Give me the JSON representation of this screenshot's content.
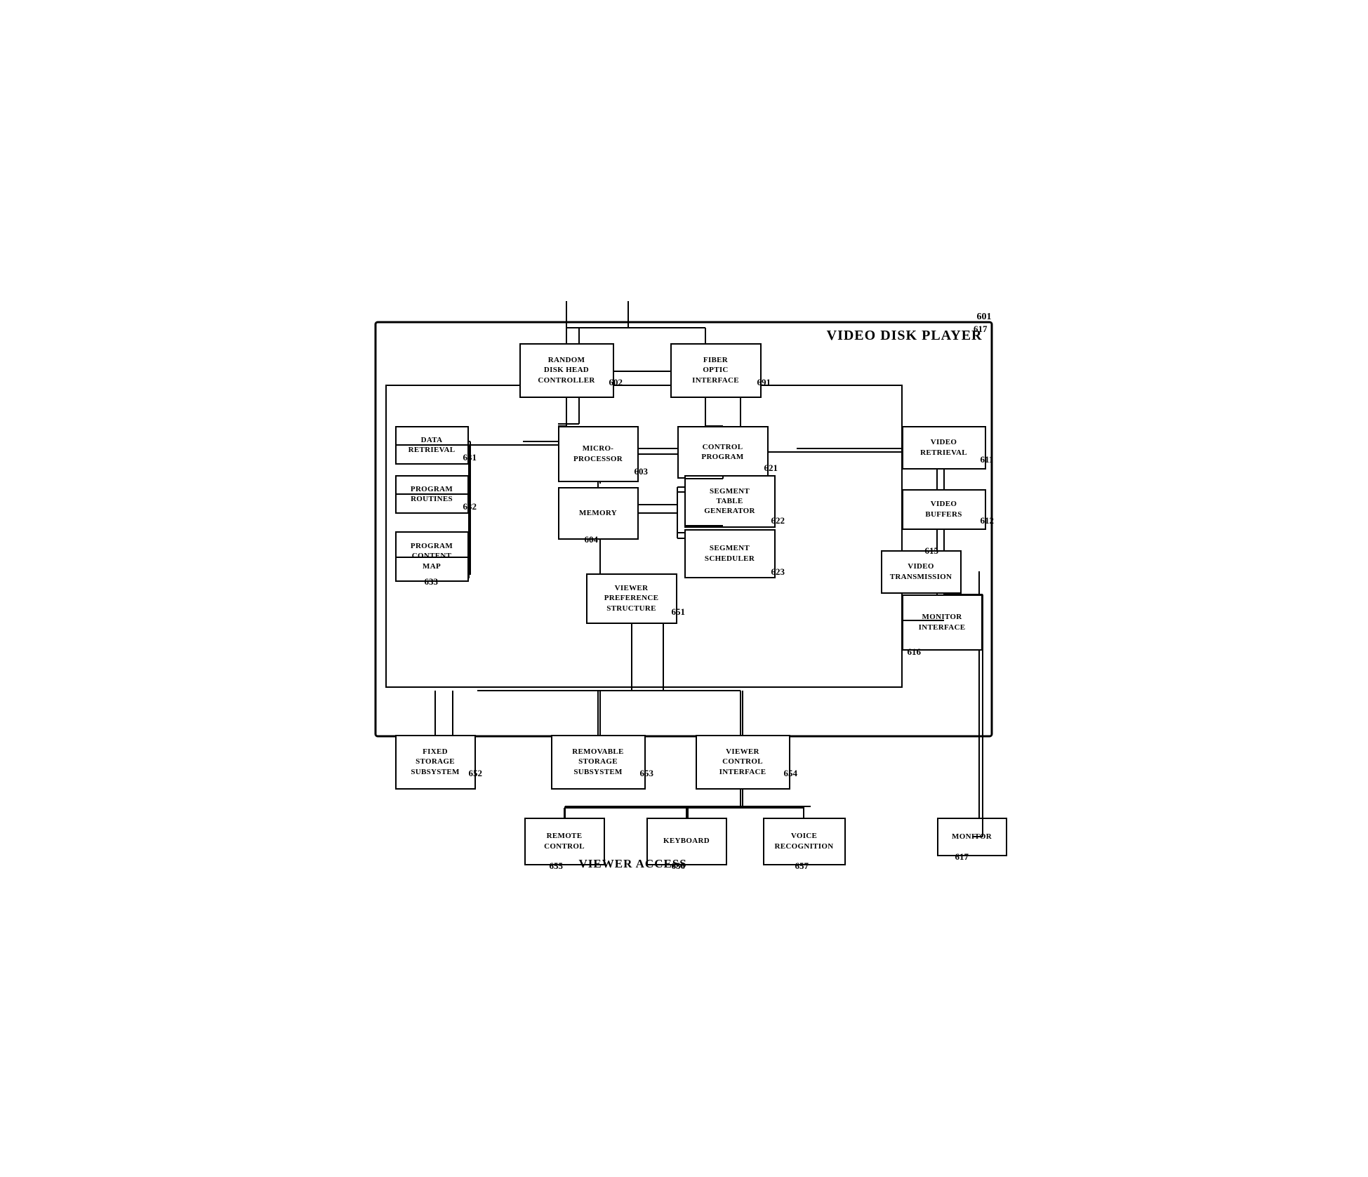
{
  "title": "VIDEO DISK PLAYER",
  "title_ref": "601",
  "blocks": {
    "random_disk_head": {
      "label": "RANDOM\nDISK HEAD\nCONTROLLER",
      "ref": "602"
    },
    "fiber_optic": {
      "label": "FIBER\nOPTIC\nINTERFACE",
      "ref": "691"
    },
    "microprocessor": {
      "label": "MICRO-\nPROCESSOR",
      "ref": "603"
    },
    "memory": {
      "label": "MEMORY",
      "ref": "604"
    },
    "control_program": {
      "label": "CONTROL\nPROGRAM",
      "ref": "621"
    },
    "segment_table": {
      "label": "SEGMENT\nTABLE\nGENERATOR",
      "ref": "622"
    },
    "segment_scheduler": {
      "label": "SEGMENT\nSCHEDULER",
      "ref": "623"
    },
    "data_retrieval": {
      "label": "DATA\nRETRIEVAL",
      "ref": "631"
    },
    "program_routines": {
      "label": "PROGRAM\nROUTINES",
      "ref": "632"
    },
    "program_content_map": {
      "label": "PROGRAM\nCONTENT\nMAP",
      "ref": "633"
    },
    "viewer_preference": {
      "label": "VIEWER\nPREFERENCE\nSTRUCTURE",
      "ref": "651"
    },
    "video_retrieval": {
      "label": "VIDEO\nRETRIEVAL",
      "ref": "611"
    },
    "video_buffers": {
      "label": "VIDEO\nBUFFERS",
      "ref": "612"
    },
    "video_transmission": {
      "label": "VIDEO\nTRANSMISSION",
      "ref": "615"
    },
    "monitor_interface": {
      "label": "MONITOR\nINTERFACE",
      "ref": "616"
    },
    "fixed_storage": {
      "label": "FIXED\nSTORAGE\nSUBSYSTEM",
      "ref": "652"
    },
    "removable_storage": {
      "label": "REMOVABLE\nSTORAGE\nSUBSYSTEM",
      "ref": "653"
    },
    "viewer_control": {
      "label": "VIEWER\nCONTROL\nINTERFACE",
      "ref": "654"
    },
    "remote_control": {
      "label": "REMOTE\nCONTROL",
      "ref": "655"
    },
    "keyboard": {
      "label": "KEYBOARD",
      "ref": "656"
    },
    "voice_recognition": {
      "label": "VOICE\nRECOGNITION",
      "ref": "657"
    },
    "monitor": {
      "label": "MONITOR",
      "ref": "617"
    }
  },
  "viewer_access_label": "VIEWER ACCESS"
}
